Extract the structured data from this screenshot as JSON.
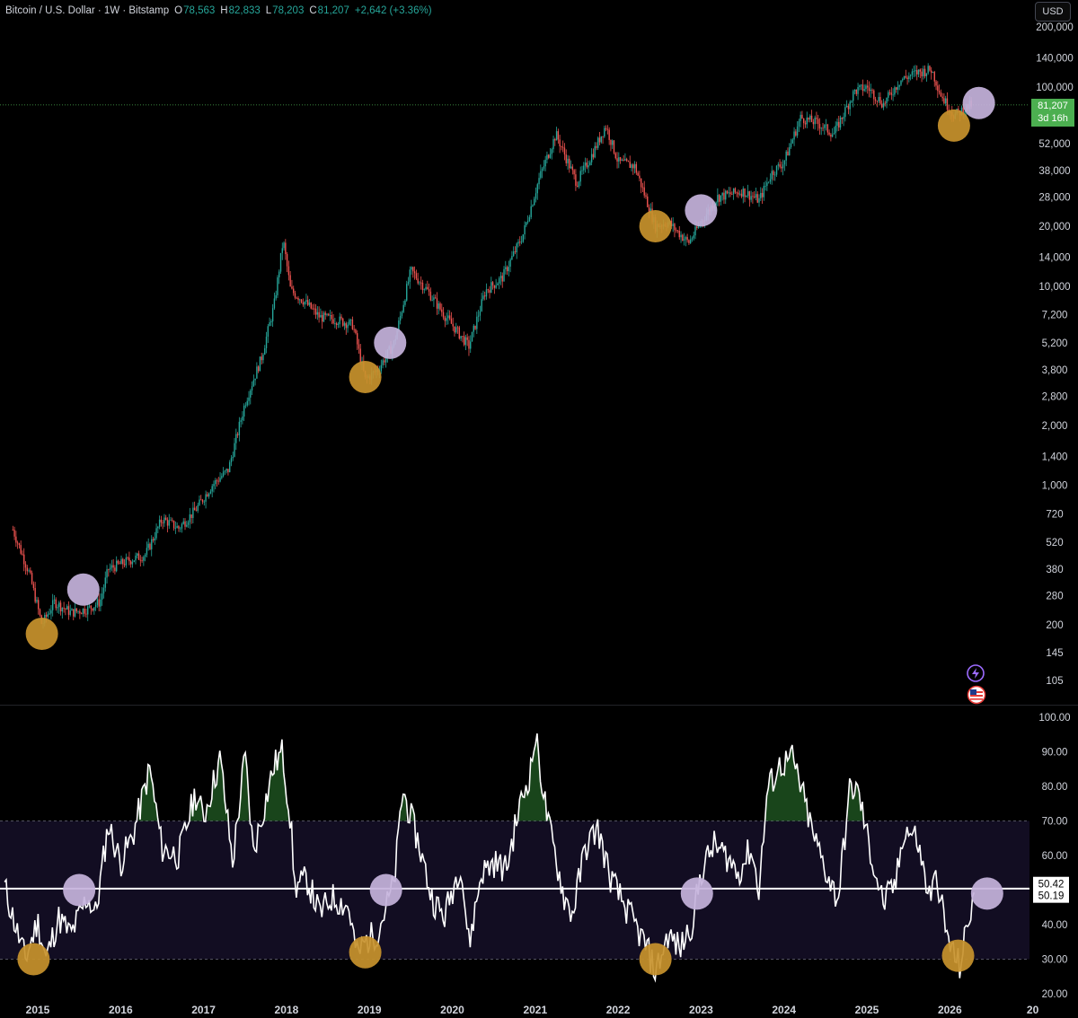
{
  "header": {
    "symbol": "Bitcoin / U.S. Dollar · 1W · Bitstamp",
    "open_label": "O",
    "open": "78,563",
    "high_label": "H",
    "high": "82,833",
    "low_label": "L",
    "low": "78,203",
    "close_label": "C",
    "close": "81,207",
    "change": "+2,642 (+3.36%)"
  },
  "currency_button": "USD",
  "price_badge": {
    "price": "81,207",
    "countdown": "3d 16h"
  },
  "colors": {
    "up": "#26a69a",
    "down": "#ef5350",
    "low_marker": "#c8932c",
    "high_marker": "#c5b3dc",
    "rsi_line": "#ffffff",
    "badge": "#4caf50"
  },
  "icons": [
    "lightning-icon",
    "us-flag-icon"
  ],
  "chart_data": [
    {
      "type": "candlestick",
      "title": "Bitcoin / U.S. Dollar · 1W · Bitstamp",
      "y_scale": "log",
      "ylim": [
        95,
        210000
      ],
      "y_ticks": [
        "200,000",
        "140,000",
        "100,000",
        "52,000",
        "38,000",
        "28,000",
        "20,000",
        "14,000",
        "10,000",
        "7,200",
        "5,200",
        "3,800",
        "2,800",
        "2,000",
        "1,400",
        "1,000",
        "720",
        "520",
        "380",
        "280",
        "200",
        "145",
        "105"
      ],
      "x_ticks": [
        "2015",
        "2016",
        "2017",
        "2018",
        "2019",
        "2020",
        "2021",
        "2022",
        "2023",
        "2024",
        "2025",
        "2026",
        "20"
      ],
      "price_path": [
        [
          2014.7,
          600
        ],
        [
          2014.9,
          360
        ],
        [
          2015.05,
          200
        ],
        [
          2015.2,
          260
        ],
        [
          2015.4,
          230
        ],
        [
          2015.6,
          240
        ],
        [
          2015.75,
          260
        ],
        [
          2015.85,
          380
        ],
        [
          2016.1,
          420
        ],
        [
          2016.3,
          450
        ],
        [
          2016.5,
          680
        ],
        [
          2016.7,
          610
        ],
        [
          2016.9,
          750
        ],
        [
          2017.1,
          1000
        ],
        [
          2017.3,
          1200
        ],
        [
          2017.5,
          2600
        ],
        [
          2017.7,
          4400
        ],
        [
          2017.85,
          8000
        ],
        [
          2017.96,
          17000
        ],
        [
          2018.05,
          9500
        ],
        [
          2018.2,
          8500
        ],
        [
          2018.4,
          7000
        ],
        [
          2018.6,
          6800
        ],
        [
          2018.8,
          6400
        ],
        [
          2018.95,
          3400
        ],
        [
          2019.1,
          3800
        ],
        [
          2019.3,
          5200
        ],
        [
          2019.5,
          12000
        ],
        [
          2019.7,
          9500
        ],
        [
          2019.9,
          7200
        ],
        [
          2020.2,
          5000
        ],
        [
          2020.4,
          9500
        ],
        [
          2020.6,
          11000
        ],
        [
          2020.85,
          18000
        ],
        [
          2021.05,
          35000
        ],
        [
          2021.25,
          58000
        ],
        [
          2021.5,
          33000
        ],
        [
          2021.7,
          47000
        ],
        [
          2021.85,
          64000
        ],
        [
          2022.0,
          42000
        ],
        [
          2022.2,
          40000
        ],
        [
          2022.45,
          20000
        ],
        [
          2022.6,
          21000
        ],
        [
          2022.85,
          16500
        ],
        [
          2023.0,
          21000
        ],
        [
          2023.2,
          28000
        ],
        [
          2023.5,
          30000
        ],
        [
          2023.7,
          27000
        ],
        [
          2023.85,
          37000
        ],
        [
          2024.0,
          42000
        ],
        [
          2024.2,
          70000
        ],
        [
          2024.4,
          66000
        ],
        [
          2024.6,
          58000
        ],
        [
          2024.85,
          95000
        ],
        [
          2025.0,
          100000
        ],
        [
          2025.2,
          82000
        ],
        [
          2025.4,
          108000
        ],
        [
          2025.6,
          118000
        ],
        [
          2025.78,
          122000
        ],
        [
          2025.9,
          90000
        ],
        [
          2026.05,
          72000
        ],
        [
          2026.25,
          81207
        ]
      ],
      "last_price": 81207,
      "markers": [
        {
          "kind": "low",
          "x": 2015.05,
          "y": 180
        },
        {
          "kind": "high",
          "x": 2015.55,
          "y": 300
        },
        {
          "kind": "low",
          "x": 2018.95,
          "y": 3500
        },
        {
          "kind": "high",
          "x": 2019.25,
          "y": 5200
        },
        {
          "kind": "low",
          "x": 2022.45,
          "y": 20000
        },
        {
          "kind": "high",
          "x": 2023.0,
          "y": 24000
        },
        {
          "kind": "low",
          "x": 2026.05,
          "y": 64000
        },
        {
          "kind": "high",
          "x": 2026.35,
          "y": 83000
        }
      ]
    },
    {
      "type": "line",
      "ylim": [
        20,
        100
      ],
      "y_ticks": [
        "100.00",
        "90.00",
        "80.00",
        "70.00",
        "60.00",
        "50.00",
        "40.00",
        "30.00",
        "20.00"
      ],
      "bands": [
        30,
        70
      ],
      "reference_line": 50.42,
      "value_labels": [
        "50.42",
        "50.19"
      ],
      "rsi_path": [
        [
          2014.6,
          51
        ],
        [
          2014.75,
          38
        ],
        [
          2014.85,
          30
        ],
        [
          2015.0,
          41
        ],
        [
          2015.1,
          30
        ],
        [
          2015.25,
          42
        ],
        [
          2015.4,
          37
        ],
        [
          2015.6,
          48
        ],
        [
          2015.7,
          43
        ],
        [
          2015.85,
          69
        ],
        [
          2016.0,
          58
        ],
        [
          2016.15,
          66
        ],
        [
          2016.35,
          85
        ],
        [
          2016.5,
          62
        ],
        [
          2016.7,
          60
        ],
        [
          2016.9,
          78
        ],
        [
          2017.0,
          71
        ],
        [
          2017.2,
          88
        ],
        [
          2017.35,
          58
        ],
        [
          2017.5,
          89
        ],
        [
          2017.6,
          61
        ],
        [
          2017.85,
          86
        ],
        [
          2017.95,
          90
        ],
        [
          2018.05,
          70
        ],
        [
          2018.1,
          51
        ],
        [
          2018.25,
          53
        ],
        [
          2018.4,
          43
        ],
        [
          2018.55,
          48
        ],
        [
          2018.75,
          45
        ],
        [
          2018.85,
          31
        ],
        [
          2018.95,
          35
        ],
        [
          2019.1,
          38
        ],
        [
          2019.3,
          52
        ],
        [
          2019.4,
          79
        ],
        [
          2019.6,
          63
        ],
        [
          2019.75,
          48
        ],
        [
          2019.9,
          42
        ],
        [
          2020.1,
          58
        ],
        [
          2020.2,
          34
        ],
        [
          2020.35,
          55
        ],
        [
          2020.5,
          58
        ],
        [
          2020.65,
          56
        ],
        [
          2020.8,
          73
        ],
        [
          2020.95,
          85
        ],
        [
          2021.0,
          95
        ],
        [
          2021.15,
          70
        ],
        [
          2021.35,
          48
        ],
        [
          2021.45,
          43
        ],
        [
          2021.6,
          62
        ],
        [
          2021.75,
          68
        ],
        [
          2021.9,
          54
        ],
        [
          2022.0,
          49
        ],
        [
          2022.2,
          40
        ],
        [
          2022.35,
          33
        ],
        [
          2022.45,
          26
        ],
        [
          2022.6,
          37
        ],
        [
          2022.75,
          33
        ],
        [
          2022.9,
          41
        ],
        [
          2023.0,
          55
        ],
        [
          2023.15,
          63
        ],
        [
          2023.3,
          60
        ],
        [
          2023.45,
          55
        ],
        [
          2023.6,
          62
        ],
        [
          2023.7,
          50
        ],
        [
          2023.8,
          79
        ],
        [
          2023.95,
          86
        ],
        [
          2024.1,
          88
        ],
        [
          2024.2,
          80
        ],
        [
          2024.35,
          66
        ],
        [
          2024.5,
          56
        ],
        [
          2024.65,
          47
        ],
        [
          2024.8,
          80
        ],
        [
          2024.9,
          78
        ],
        [
          2025.05,
          60
        ],
        [
          2025.2,
          46
        ],
        [
          2025.35,
          52
        ],
        [
          2025.45,
          68
        ],
        [
          2025.6,
          65
        ],
        [
          2025.75,
          48
        ],
        [
          2025.85,
          54
        ],
        [
          2025.95,
          38
        ],
        [
          2026.05,
          31
        ],
        [
          2026.12,
          28
        ],
        [
          2026.2,
          38
        ],
        [
          2026.3,
          50
        ]
      ],
      "markers": [
        {
          "kind": "low",
          "x": 2014.95,
          "y": 30
        },
        {
          "kind": "high",
          "x": 2015.5,
          "y": 50
        },
        {
          "kind": "low",
          "x": 2018.95,
          "y": 32
        },
        {
          "kind": "high",
          "x": 2019.2,
          "y": 50
        },
        {
          "kind": "low",
          "x": 2022.45,
          "y": 30
        },
        {
          "kind": "high",
          "x": 2022.95,
          "y": 49
        },
        {
          "kind": "low",
          "x": 2026.1,
          "y": 31
        },
        {
          "kind": "high",
          "x": 2026.45,
          "y": 49
        }
      ]
    }
  ]
}
